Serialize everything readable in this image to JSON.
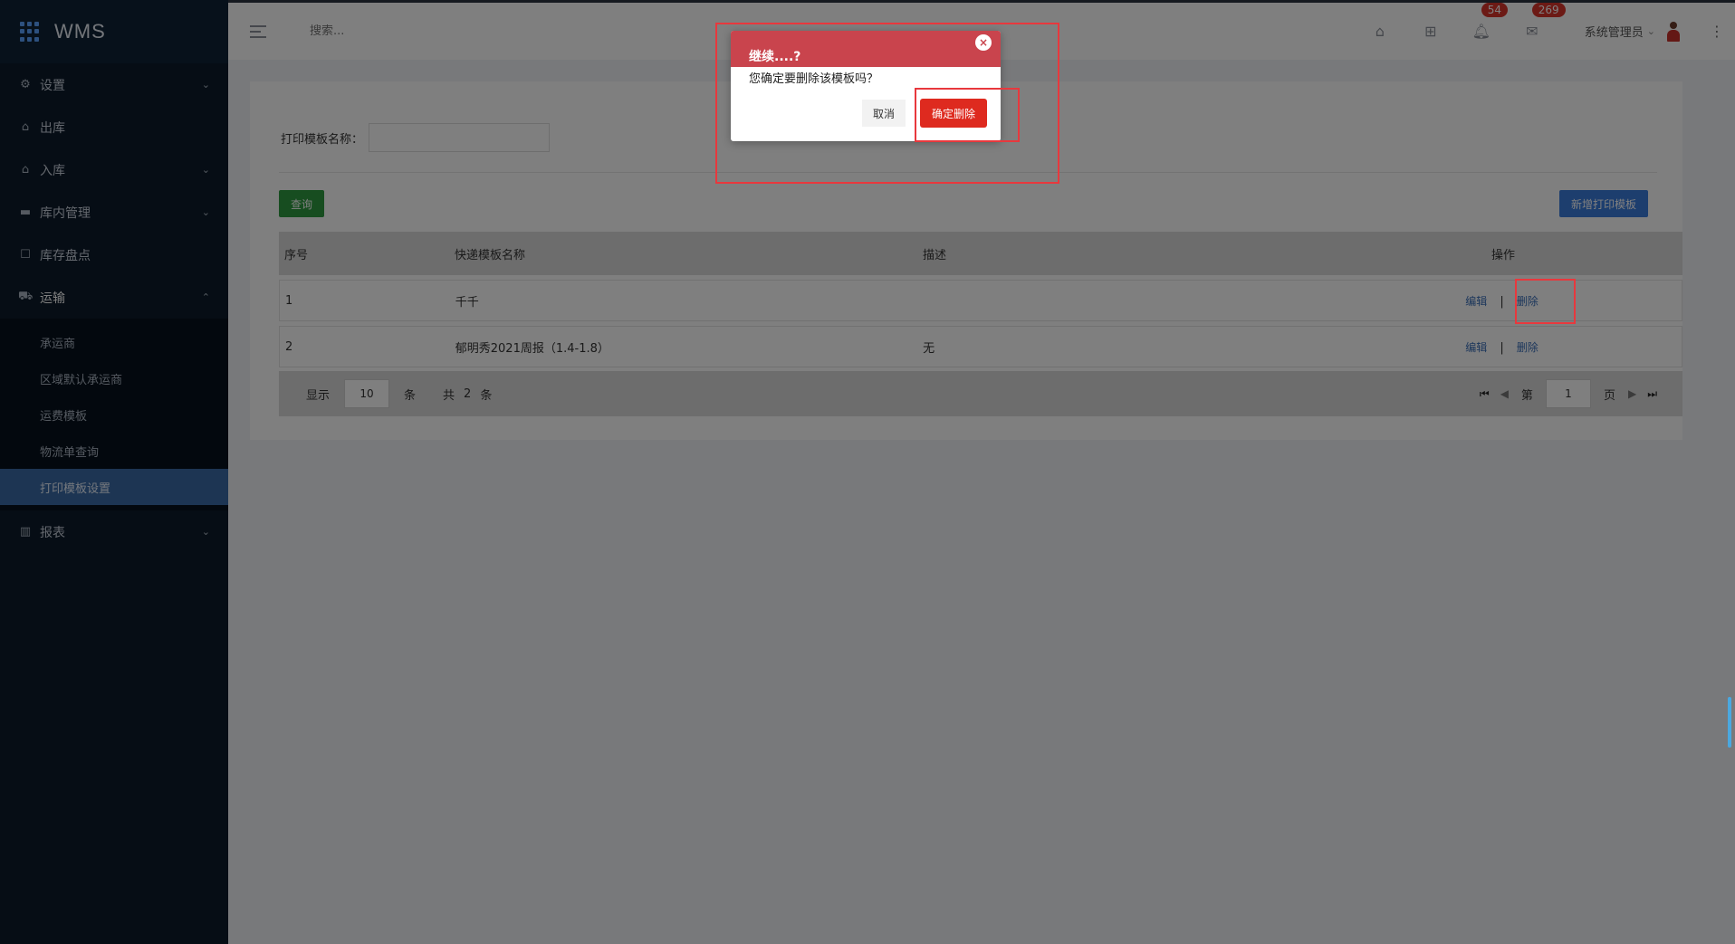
{
  "brand": {
    "title": "WMS"
  },
  "sidebar": {
    "items": [
      {
        "label": "设置",
        "icon": "gear-icon"
      },
      {
        "label": "出库",
        "icon": "outbound-icon"
      },
      {
        "label": "入库",
        "icon": "inbound-icon"
      },
      {
        "label": "库内管理",
        "icon": "warehouse-icon"
      },
      {
        "label": "库存盘点",
        "icon": "inventory-icon"
      },
      {
        "label": "运输",
        "icon": "truck-icon"
      },
      {
        "label": "报表",
        "icon": "bar-chart-icon"
      }
    ],
    "sub_items": [
      "承运商",
      "区域默认承运商",
      "运费模板",
      "物流单查询",
      "打印模板设置"
    ]
  },
  "header": {
    "search_placeholder": "搜索...",
    "badge_bell": "54",
    "badge_mail": "269",
    "user_name": "系统管理员"
  },
  "filter": {
    "label": "打印模板名称："
  },
  "toolbar": {
    "query_label": "查询",
    "new_label": "新增打印模板"
  },
  "table": {
    "headers": [
      "序号",
      "快递模板名称",
      "描述",
      "操作"
    ],
    "rows": [
      {
        "no": "1",
        "name": "千千",
        "desc": "",
        "edit": "编辑",
        "sep": "|",
        "del": "删除"
      },
      {
        "no": "2",
        "name": "郁明秀2021周报（1.4-1.8）",
        "desc": "无",
        "edit": "编辑",
        "sep": "|",
        "del": "删除"
      }
    ]
  },
  "pager": {
    "show_label": "显示",
    "page_size": "10",
    "unit": "条",
    "total_prefix": "共",
    "total": "2",
    "total_unit": "条",
    "page_prefix": "第",
    "page": "1",
    "page_suffix": "页"
  },
  "dialog": {
    "title": "继续....?",
    "close": "×",
    "message": "您确定要删除该模板吗？",
    "cancel_label": "取消",
    "confirm_label": "确定删除"
  },
  "colors": {
    "sidebar_bg": "#0d1b2a",
    "active_item": "#3a6aa6",
    "dialog_header": "#c9444d",
    "confirm_button": "#de2a1f",
    "query_button": "#2f9a41",
    "new_button": "#3b7ddd",
    "annotation": "#e8383d"
  }
}
